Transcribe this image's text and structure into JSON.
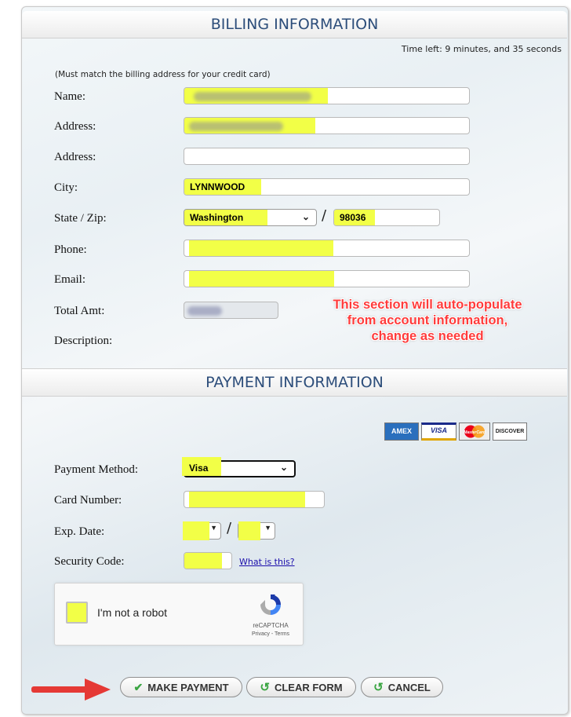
{
  "billing": {
    "header": "BILLING INFORMATION",
    "time_left": "Time left: 9 minutes, and 35 seconds",
    "note": "(Must match the billing address for your credit card)",
    "labels": {
      "name": "Name:",
      "address1": "Address:",
      "address2": "Address:",
      "city": "City:",
      "state_zip": "State / Zip:",
      "phone": "Phone:",
      "email": "Email:",
      "total": "Total Amt:",
      "description": "Description:"
    },
    "values": {
      "city": "LYNNWOOD",
      "state": "Washington",
      "zip": "98036"
    },
    "separator": "/"
  },
  "annotation": {
    "line1": "This section will auto-populate",
    "line2": "from account information,",
    "line3": "change as needed"
  },
  "payment": {
    "header": "PAYMENT INFORMATION",
    "cards": [
      "AMEX",
      "VISA",
      "MasterCard",
      "DISCOVER"
    ],
    "labels": {
      "method": "Payment Method:",
      "card_number": "Card Number:",
      "exp_date": "Exp. Date:",
      "security_code": "Security Code:"
    },
    "values": {
      "method": "Visa"
    },
    "exp_separator": "/",
    "what_is_this": "What is this?"
  },
  "recaptcha": {
    "label": "I'm not a robot",
    "brand": "reCAPTCHA",
    "links": "Privacy - Terms"
  },
  "buttons": {
    "make_payment": "MAKE PAYMENT",
    "clear_form": "CLEAR FORM",
    "cancel": "CANCEL"
  },
  "colors": {
    "highlight": "#f2ff47",
    "header_text": "#2c4d7a",
    "annotation": "#ff3b3b",
    "arrow": "#e53935"
  }
}
